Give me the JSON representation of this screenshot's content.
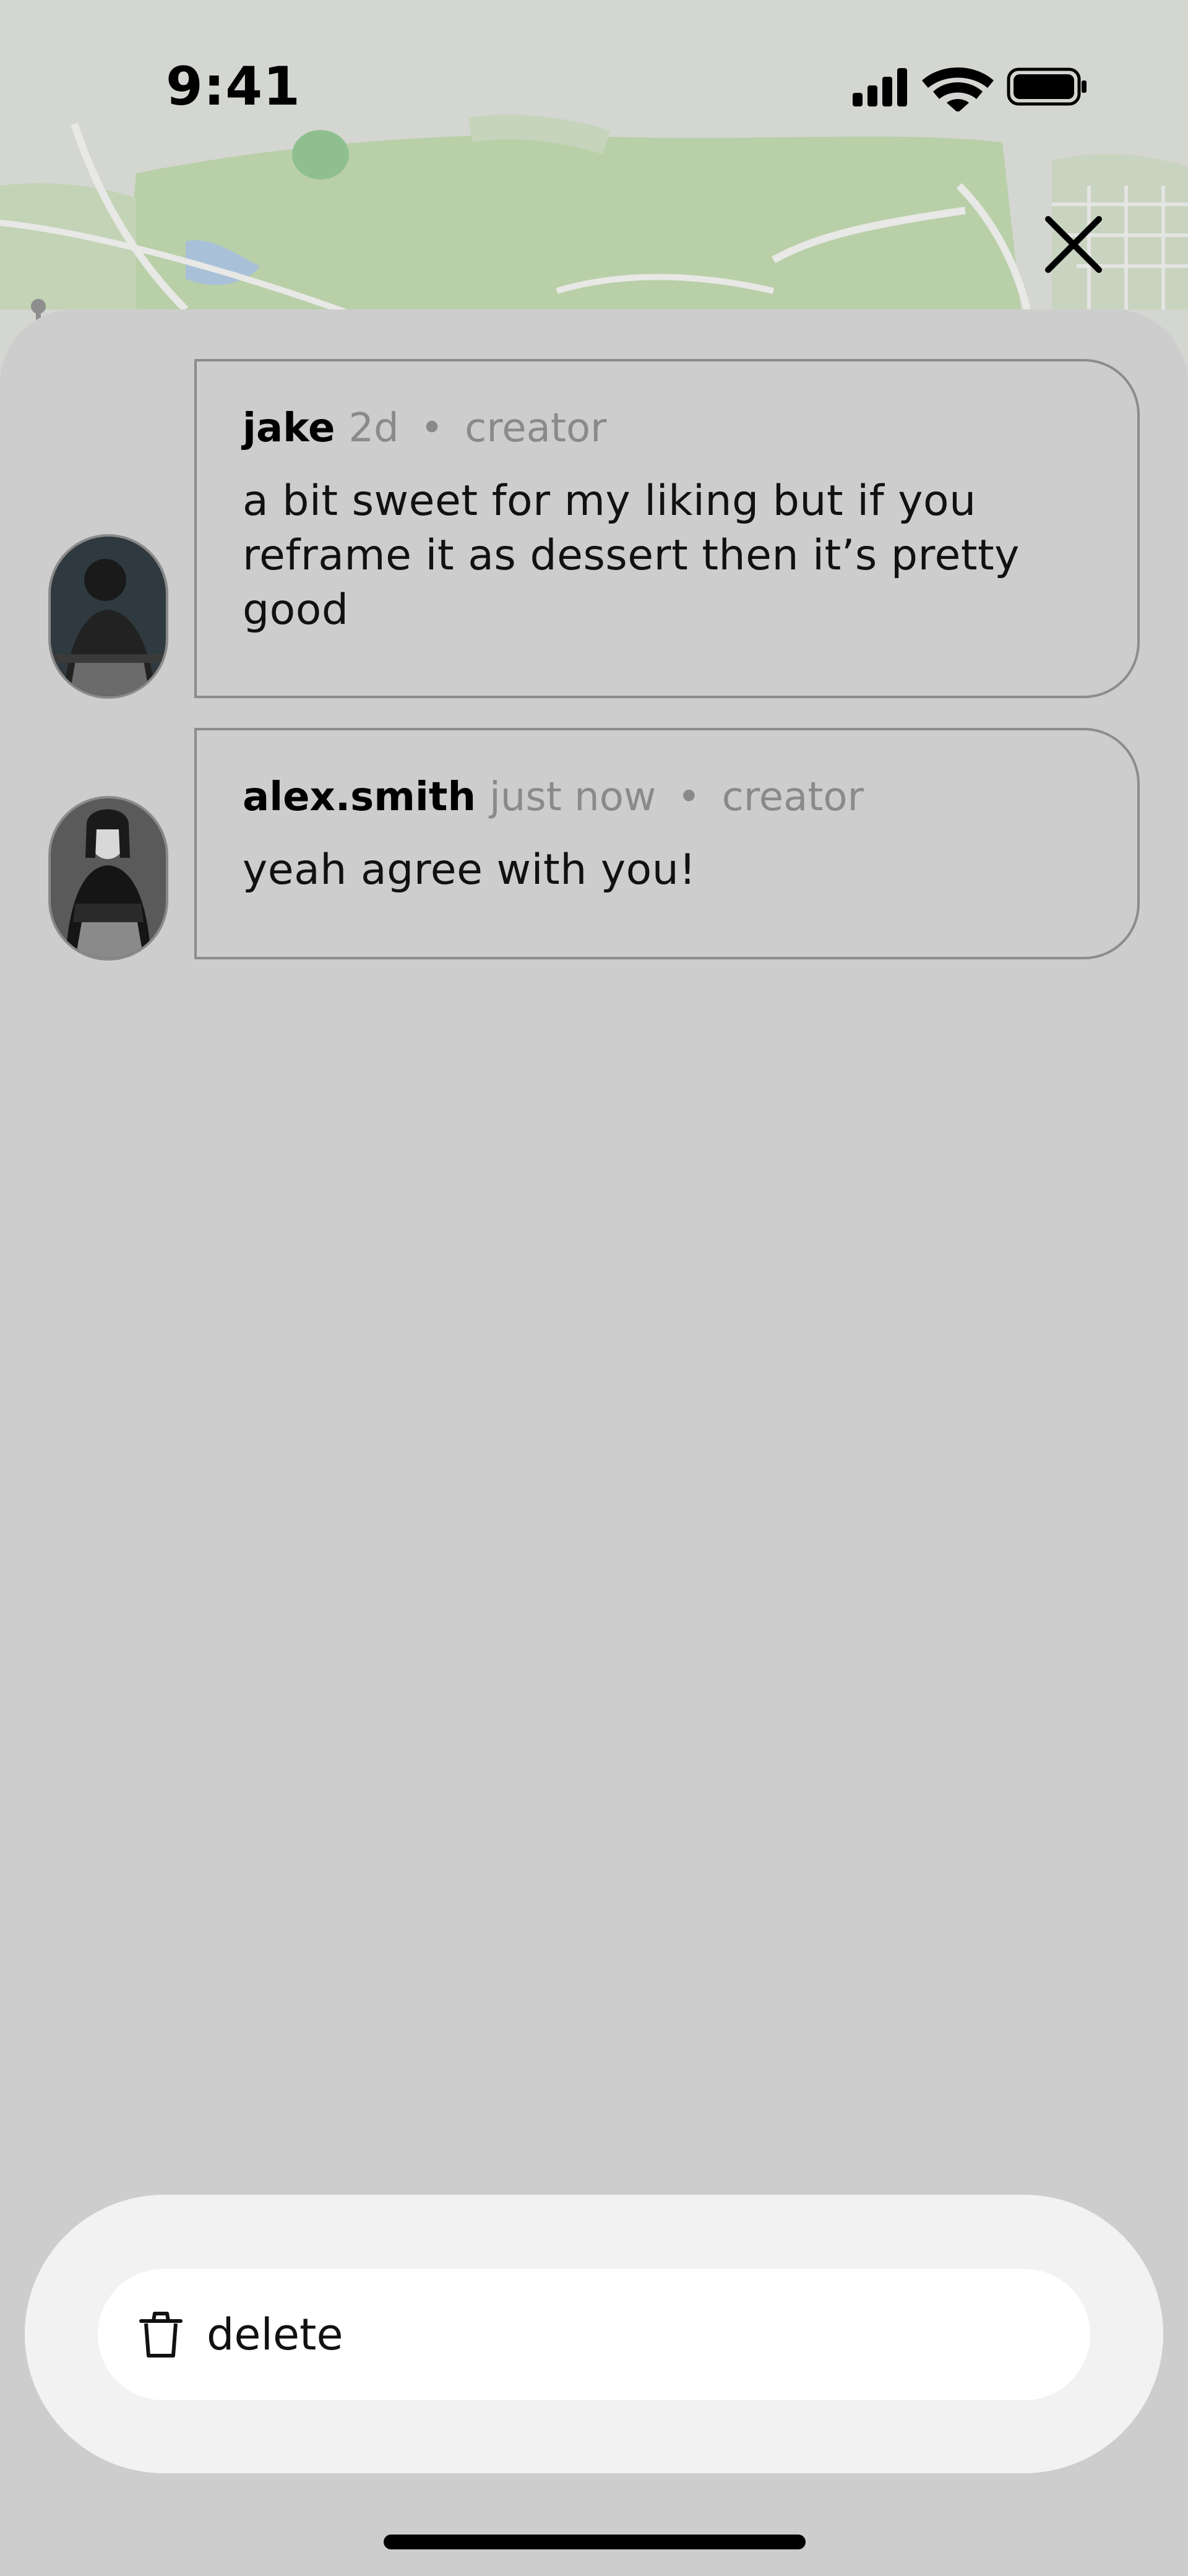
{
  "status_bar": {
    "time": "9:41",
    "icons": [
      "signal-icon",
      "wifi-icon",
      "battery-icon"
    ]
  },
  "colors": {
    "background": "#cdcdcd",
    "text_primary": "#000000",
    "text_subtle": "#8a8a8a",
    "action_sheet": "#f2f2f2",
    "button_bg": "#ffffff",
    "map_green": "#b9cfa8"
  },
  "close_button": {
    "icon": "close-icon"
  },
  "comments": [
    {
      "username": "jake",
      "timestamp": "2d",
      "separator": "•",
      "role": "creator",
      "text": "a bit sweet for my liking but if you reframe it as dessert then it’s pretty good"
    },
    {
      "username": "alex.smith",
      "timestamp": "just now",
      "separator": "•",
      "role": "creator",
      "text": "yeah agree with you!"
    }
  ],
  "actions": {
    "delete_label": "delete",
    "delete_icon": "trash-icon"
  }
}
